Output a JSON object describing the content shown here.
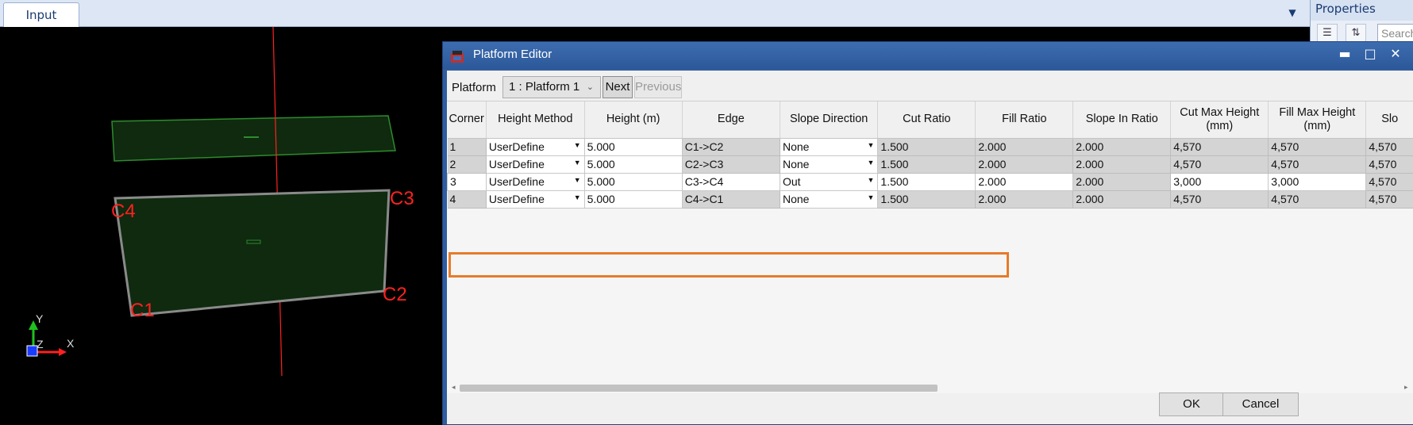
{
  "tabs": {
    "input": "Input",
    "dropdown_icon": "chevron-down-icon"
  },
  "viewport": {
    "labels": {
      "c1": "C1",
      "c2": "C2",
      "c3": "C3",
      "c4": "C4"
    },
    "axis": {
      "y": "Y",
      "z": "Z",
      "x": "X"
    },
    "colors": {
      "background": "#000000",
      "platform_fill": "#0f2a0f",
      "platform_edge": "#8a8a8a",
      "ghost_edge": "#2e8b2e",
      "axis_line": "#ff2020",
      "label": "#ff2020"
    }
  },
  "properties": {
    "title": "Properties",
    "search_placeholder": "Search"
  },
  "dialog": {
    "title": "Platform Editor",
    "platform_label": "Platform",
    "platform_selected": "1 : Platform 1",
    "next": "Next",
    "previous": "Previous",
    "ok": "OK",
    "cancel": "Cancel",
    "columns": [
      "Corner",
      "Height Method",
      "Height (m)",
      "Edge",
      "Slope Direction",
      "Cut Ratio",
      "Fill Ratio",
      "Slope In Ratio",
      "Cut Max Height (mm)",
      "Fill Max Height (mm)",
      "Slo"
    ],
    "rows": [
      {
        "corner": "1",
        "method": "UserDefine",
        "height": "5.000",
        "edge": "C1->C2",
        "direction": "None",
        "cut": "1.500",
        "fill": "2.000",
        "slope_in": "2.000",
        "cut_max": "4,570",
        "fill_max": "4,570",
        "slo": "4,570"
      },
      {
        "corner": "2",
        "method": "UserDefine",
        "height": "5.000",
        "edge": "C2->C3",
        "direction": "None",
        "cut": "1.500",
        "fill": "2.000",
        "slope_in": "2.000",
        "cut_max": "4,570",
        "fill_max": "4,570",
        "slo": "4,570"
      },
      {
        "corner": "3",
        "method": "UserDefine",
        "height": "5.000",
        "edge": "C3->C4",
        "direction": "Out",
        "cut": "1.500",
        "fill": "2.000",
        "slope_in": "2.000",
        "cut_max": "3,000",
        "fill_max": "3,000",
        "slo": "4,570"
      },
      {
        "corner": "4",
        "method": "UserDefine",
        "height": "5.000",
        "edge": "C4->C1",
        "direction": "None",
        "cut": "1.500",
        "fill": "2.000",
        "slope_in": "2.000",
        "cut_max": "4,570",
        "fill_max": "4,570",
        "slo": "4,570"
      }
    ],
    "highlight_color": "#e67b2a"
  }
}
